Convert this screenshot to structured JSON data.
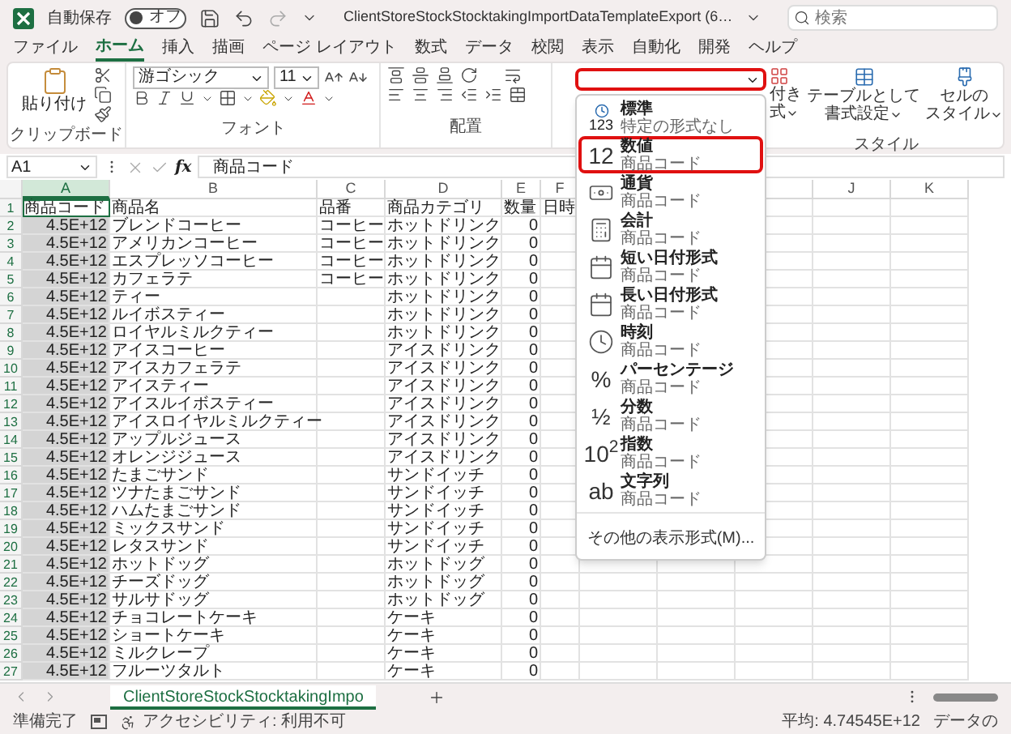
{
  "title_bar": {
    "autosave_label": "自動保存",
    "autosave": {
      "on": false,
      "label": "オフ"
    },
    "title": "ClientStoreStockStocktakingImportDataTemplateExport (6…",
    "search_placeholder": "検索"
  },
  "menu_tabs": [
    {
      "label": "ファイル",
      "selected": false
    },
    {
      "label": "ホーム",
      "selected": true
    },
    {
      "label": "挿入",
      "selected": false
    },
    {
      "label": "描画",
      "selected": false
    },
    {
      "label": "ページ レイアウト",
      "selected": false
    },
    {
      "label": "数式",
      "selected": false
    },
    {
      "label": "データ",
      "selected": false
    },
    {
      "label": "校閲",
      "selected": false
    },
    {
      "label": "表示",
      "selected": false
    },
    {
      "label": "自動化",
      "selected": false
    },
    {
      "label": "開発",
      "selected": false
    },
    {
      "label": "ヘルプ",
      "selected": false
    }
  ],
  "ribbon": {
    "clipboard": {
      "paste_label": "貼り付け",
      "group_label": "クリップボード"
    },
    "font": {
      "name": "游ゴシック",
      "size": "11",
      "group_label": "フォント"
    },
    "alignment": {
      "group_label": "配置"
    },
    "number_format": {
      "highlighted": true
    },
    "styles": {
      "conditional": [
        "付き",
        "式"
      ],
      "table": [
        "テーブルとして",
        "書式設定"
      ],
      "cell": [
        "セルの",
        "スタイル"
      ],
      "group_label": "スタイル"
    }
  },
  "format_menu": {
    "items": [
      {
        "kind": "general",
        "glyph": "123",
        "title": "標準",
        "subtitle": "特定の形式なし",
        "highlighted": false
      },
      {
        "kind": "number",
        "glyph": "12",
        "title": "数値",
        "subtitle": "商品コード",
        "highlighted": true
      },
      {
        "kind": "currency",
        "title": "通貨",
        "subtitle": "商品コード",
        "highlighted": false
      },
      {
        "kind": "accounting",
        "title": "会計",
        "subtitle": "商品コード",
        "highlighted": false
      },
      {
        "kind": "short_date",
        "title": "短い日付形式",
        "subtitle": "商品コード",
        "highlighted": false
      },
      {
        "kind": "long_date",
        "title": "長い日付形式",
        "subtitle": "商品コード",
        "highlighted": false
      },
      {
        "kind": "time",
        "title": "時刻",
        "subtitle": "商品コード",
        "highlighted": false
      },
      {
        "kind": "percent",
        "glyph": "%",
        "title": "パーセンテージ",
        "subtitle": "商品コード",
        "highlighted": false
      },
      {
        "kind": "fraction",
        "glyph": "½",
        "title": "分数",
        "subtitle": "商品コード",
        "highlighted": false
      },
      {
        "kind": "scientific",
        "glyph": "10$^{2}$",
        "title": "指数",
        "subtitle": "商品コード",
        "highlighted": false
      },
      {
        "kind": "text",
        "glyph": "ab",
        "title": "文字列",
        "subtitle": "商品コード",
        "highlighted": false
      }
    ],
    "footer": "その他の表示形式(M)..."
  },
  "formula_bar": {
    "name_box": "A1",
    "function_glyph": "fx",
    "formula": "商品コード"
  },
  "sheet": {
    "columns": [
      {
        "label": "A",
        "selected": true
      },
      {
        "label": "B",
        "selected": false
      },
      {
        "label": "C",
        "selected": false
      },
      {
        "label": "D",
        "selected": false
      },
      {
        "label": "E",
        "selected": false
      },
      {
        "label": "F",
        "selected": false
      },
      {
        "label": "J",
        "selected": false
      },
      {
        "label": "K",
        "selected": false
      }
    ],
    "rows": [
      {
        "number": "1",
        "cells": [
          "商品コード",
          "商品名",
          "品番",
          "商品カテゴリ",
          "数量",
          "日時"
        ]
      },
      {
        "number": "2",
        "cells": [
          "4.5E+12",
          "ブレンドコーヒー",
          "コーヒー",
          "ホットドリンク",
          "0"
        ]
      },
      {
        "number": "3",
        "cells": [
          "4.5E+12",
          "アメリカンコーヒー",
          "コーヒー",
          "ホットドリンク",
          "0"
        ]
      },
      {
        "number": "4",
        "cells": [
          "4.5E+12",
          "エスプレッソコーヒー",
          "コーヒー",
          "ホットドリンク",
          "0"
        ]
      },
      {
        "number": "5",
        "cells": [
          "4.5E+12",
          "カフェラテ",
          "コーヒー",
          "ホットドリンク",
          "0"
        ]
      },
      {
        "number": "6",
        "cells": [
          "4.5E+12",
          "ティー",
          null,
          "ホットドリンク",
          "0"
        ]
      },
      {
        "number": "7",
        "cells": [
          "4.5E+12",
          "ルイボスティー",
          null,
          "ホットドリンク",
          "0"
        ]
      },
      {
        "number": "8",
        "cells": [
          "4.5E+12",
          "ロイヤルミルクティー",
          null,
          "ホットドリンク",
          "0"
        ]
      },
      {
        "number": "9",
        "cells": [
          "4.5E+12",
          "アイスコーヒー",
          null,
          "アイスドリンク",
          "0"
        ]
      },
      {
        "number": "10",
        "cells": [
          "4.5E+12",
          "アイスカフェラテ",
          null,
          "アイスドリンク",
          "0"
        ]
      },
      {
        "number": "11",
        "cells": [
          "4.5E+12",
          "アイスティー",
          null,
          "アイスドリンク",
          "0"
        ]
      },
      {
        "number": "12",
        "cells": [
          "4.5E+12",
          "アイスルイボスティー",
          null,
          "アイスドリンク",
          "0"
        ]
      },
      {
        "number": "13",
        "cells": [
          "4.5E+12",
          "アイスロイヤルミルクティー",
          null,
          "アイスドリンク",
          "0"
        ]
      },
      {
        "number": "14",
        "cells": [
          "4.5E+12",
          "アップルジュース",
          null,
          "アイスドリンク",
          "0"
        ]
      },
      {
        "number": "15",
        "cells": [
          "4.5E+12",
          "オレンジジュース",
          null,
          "アイスドリンク",
          "0"
        ]
      },
      {
        "number": "16",
        "cells": [
          "4.5E+12",
          "たまごサンド",
          null,
          "サンドイッチ",
          "0"
        ]
      },
      {
        "number": "17",
        "cells": [
          "4.5E+12",
          "ツナたまごサンド",
          null,
          "サンドイッチ",
          "0"
        ]
      },
      {
        "number": "18",
        "cells": [
          "4.5E+12",
          "ハムたまごサンド",
          null,
          "サンドイッチ",
          "0"
        ]
      },
      {
        "number": "19",
        "cells": [
          "4.5E+12",
          "ミックスサンド",
          null,
          "サンドイッチ",
          "0"
        ]
      },
      {
        "number": "20",
        "cells": [
          "4.5E+12",
          "レタスサンド",
          null,
          "サンドイッチ",
          "0"
        ]
      },
      {
        "number": "21",
        "cells": [
          "4.5E+12",
          "ホットドッグ",
          null,
          "ホットドッグ",
          "0"
        ]
      },
      {
        "number": "22",
        "cells": [
          "4.5E+12",
          "チーズドッグ",
          null,
          "ホットドッグ",
          "0"
        ]
      },
      {
        "number": "23",
        "cells": [
          "4.5E+12",
          "サルサドッグ",
          null,
          "ホットドッグ",
          "0"
        ]
      },
      {
        "number": "24",
        "cells": [
          "4.5E+12",
          "チョコレートケーキ",
          null,
          "ケーキ",
          "0"
        ]
      },
      {
        "number": "25",
        "cells": [
          "4.5E+12",
          "ショートケーキ",
          null,
          "ケーキ",
          "0"
        ]
      },
      {
        "number": "26",
        "cells": [
          "4.5E+12",
          "ミルクレープ",
          null,
          "ケーキ",
          "0"
        ]
      },
      {
        "number": "27",
        "cells": [
          "4.5E+12",
          "フルーツタルト",
          null,
          "ケーキ",
          "0"
        ]
      }
    ]
  },
  "sheet_tabs": [
    {
      "label": "ClientStoreStockStocktakingImpo",
      "selected": true
    }
  ],
  "status_bar": {
    "ready": "準備完了",
    "accessibility": "アクセシビリティ: 利用不可",
    "average": "平均: 4.74545E+12",
    "count": "データの"
  }
}
